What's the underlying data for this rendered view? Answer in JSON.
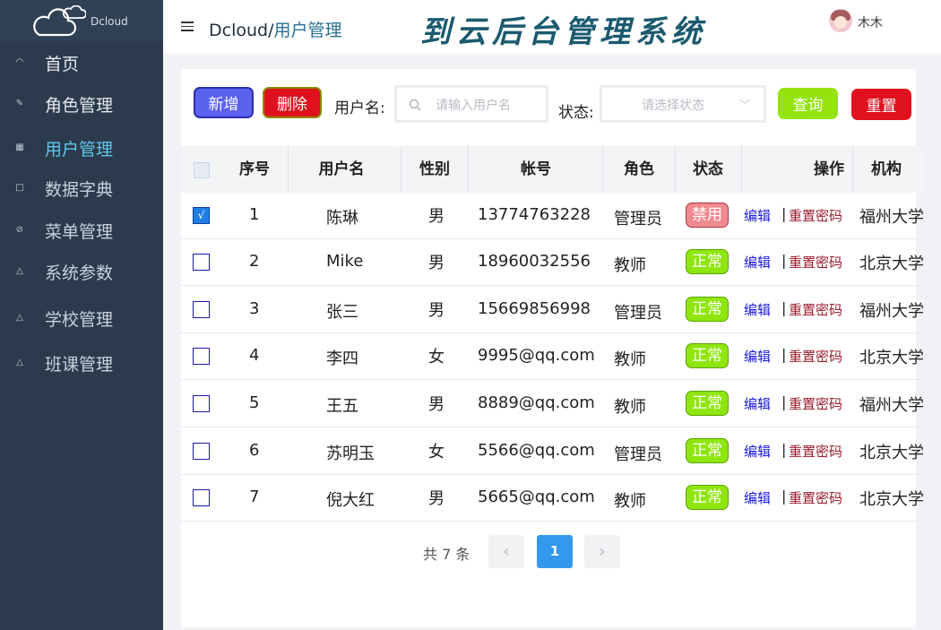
{
  "app": {
    "brand": "Dcloud",
    "site_title": "到云后台管理系统",
    "user_name": "木木"
  },
  "breadcrumb": {
    "root": "Dcloud/",
    "current": "用户管理"
  },
  "sidebar": {
    "items": [
      {
        "label": "首页",
        "icon": "home-icon"
      },
      {
        "label": "角色管理",
        "icon": "edit-icon"
      },
      {
        "label": "用户管理",
        "icon": "table-icon",
        "active": true
      },
      {
        "label": "数据字典",
        "icon": "square-icon"
      },
      {
        "label": "菜单管理",
        "icon": "compass-icon"
      },
      {
        "label": "系统参数",
        "icon": "triangle-icon"
      },
      {
        "label": "学校管理",
        "icon": "triangle-icon"
      },
      {
        "label": "班课管理",
        "icon": "triangle-icon"
      }
    ]
  },
  "toolbar": {
    "add_label": "新增",
    "delete_label": "删除",
    "username_label": "用户名:",
    "username_placeholder": "请输入用户名",
    "status_label": "状态:",
    "status_placeholder": "请选择状态",
    "query_label": "查询",
    "reset_label": "重置"
  },
  "table": {
    "headers": [
      "序号",
      "用户名",
      "性别",
      "帐号",
      "角色",
      "状态",
      "操作",
      "机构"
    ],
    "edit_label": "编辑",
    "reset_pwd_label": "重置密码",
    "rows": [
      {
        "no": "1",
        "name": "陈琳",
        "gender": "男",
        "account": "13774763228",
        "role": "管理员",
        "status": "禁用",
        "org": "福州大学",
        "checked": true
      },
      {
        "no": "2",
        "name": "Mike",
        "gender": "男",
        "account": "18960032556",
        "role": "教师",
        "status": "正常",
        "org": "北京大学",
        "checked": false
      },
      {
        "no": "3",
        "name": "张三",
        "gender": "男",
        "account": "15669856998",
        "role": "管理员",
        "status": "正常",
        "org": "福州大学",
        "checked": false
      },
      {
        "no": "4",
        "name": "李四",
        "gender": "女",
        "account": "9995@qq.com",
        "role": "教师",
        "status": "正常",
        "org": "北京大学",
        "checked": false
      },
      {
        "no": "5",
        "name": "王五",
        "gender": "男",
        "account": "8889@qq.com",
        "role": "教师",
        "status": "正常",
        "org": "福州大学",
        "checked": false
      },
      {
        "no": "6",
        "name": "苏明玉",
        "gender": "女",
        "account": "5566@qq.com",
        "role": "管理员",
        "status": "正常",
        "org": "北京大学",
        "checked": false
      },
      {
        "no": "7",
        "name": "倪大红",
        "gender": "男",
        "account": "5665@qq.com",
        "role": "教师",
        "status": "正常",
        "org": "北京大学",
        "checked": false
      }
    ]
  },
  "pagination": {
    "total_text": "共 7 条",
    "current_page": "1",
    "prev": "‹",
    "next": "›"
  },
  "colors": {
    "sidebar": "#2c3a4d",
    "active_menu": "#5ec9e9",
    "ok_badge": "#8ee60e",
    "ban_badge": "#f08a90",
    "primary": "#3399ef"
  }
}
